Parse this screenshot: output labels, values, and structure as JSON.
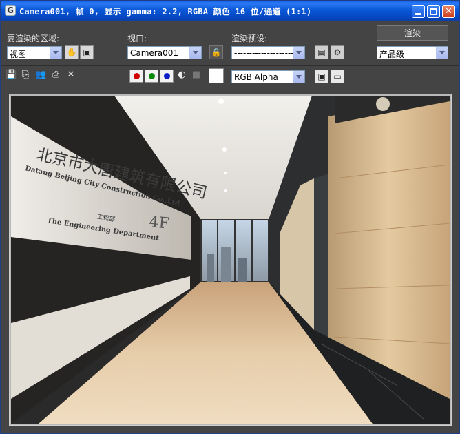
{
  "window": {
    "title": "Camera001, 帧 0, 显示 gamma: 2.2, RGBA 颜色 16 位/通道 (1:1)",
    "app_icon": "3ds-max-icon"
  },
  "top_panel": {
    "area_label": "要渲染的区域:",
    "area_value": "视图",
    "viewport_label": "视口:",
    "viewport_value": "Camera001",
    "preset_label": "渲染预设:",
    "preset_value": "--------------------",
    "render_button": "渲染",
    "quality_value": "产品级"
  },
  "toolbar": {
    "channel_value": "RGB Alpha",
    "channels": [
      {
        "name": "red",
        "color": "#d00000"
      },
      {
        "name": "green",
        "color": "#0a8a0a"
      },
      {
        "name": "blue",
        "color": "#0a1ac8"
      }
    ],
    "color_swatch": "#ffffff"
  },
  "render_image": {
    "sign_cn": "北京市大唐建筑有限公司",
    "sign_en_1": "Datang Beijing City Construction Co.,Ltd",
    "sign_dept_cn": "工程部",
    "sign_en_2": "The Engineering Department",
    "floor_number": "4F"
  }
}
